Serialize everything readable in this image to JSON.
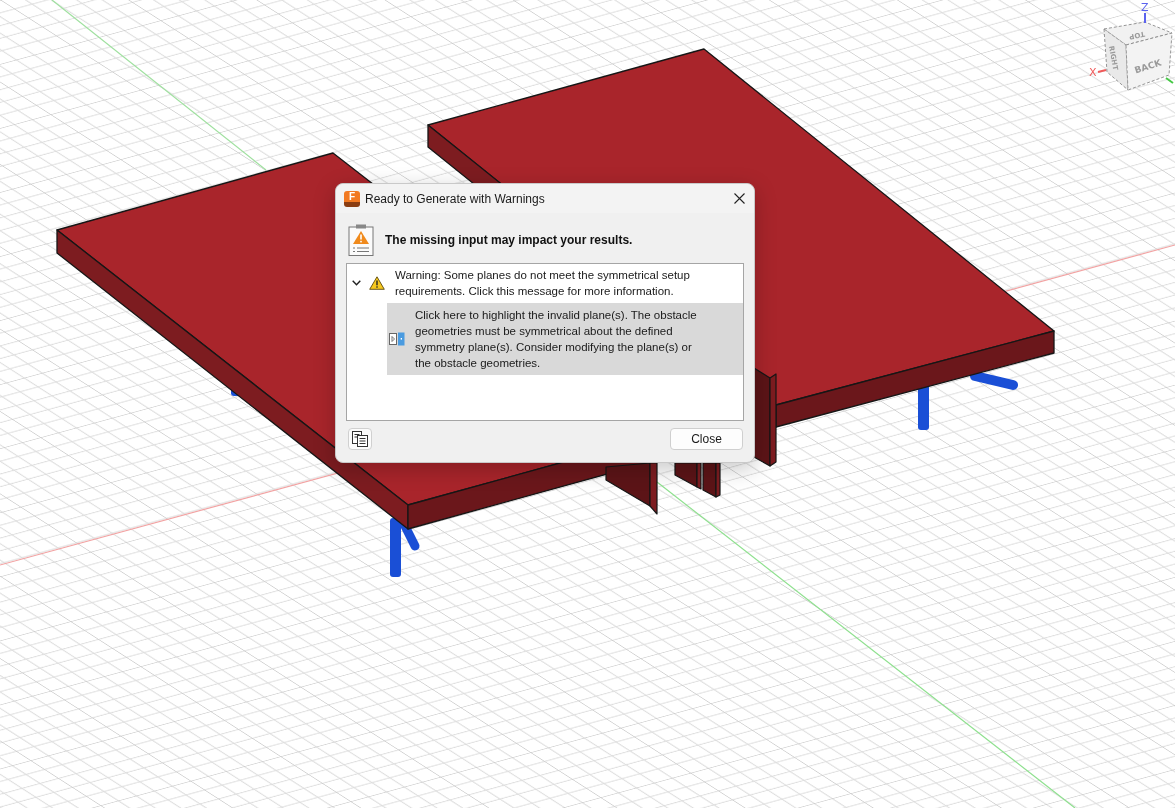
{
  "viewport": {
    "view_cube": {
      "labels": [
        {
          "kind": "top",
          "text": "TOP"
        },
        {
          "kind": "left",
          "text": "RIGHT"
        },
        {
          "kind": "right",
          "text": "BACK"
        }
      ],
      "axes": [
        {
          "kind": "z",
          "text": "Z"
        },
        {
          "kind": "x",
          "text": "X"
        }
      ]
    }
  },
  "dialog": {
    "logo_letter": "F",
    "title": "Ready to Generate with Warnings",
    "headline": "The missing input may impact your results.",
    "messages": [
      {
        "kind": "warning",
        "text": "Warning: Some planes do not meet the symmetrical setup requirements. Click this message for more information.",
        "expanded": true,
        "selected": false,
        "children": [
          {
            "kind": "action",
            "text": "Click here to highlight the invalid plane(s). The obstacle geometries must be symmetrical about the defined symmetry plane(s). Consider modifying the plane(s) or the obstacle geometries.",
            "selected": true
          }
        ]
      }
    ],
    "buttons": [
      "Close"
    ]
  }
}
